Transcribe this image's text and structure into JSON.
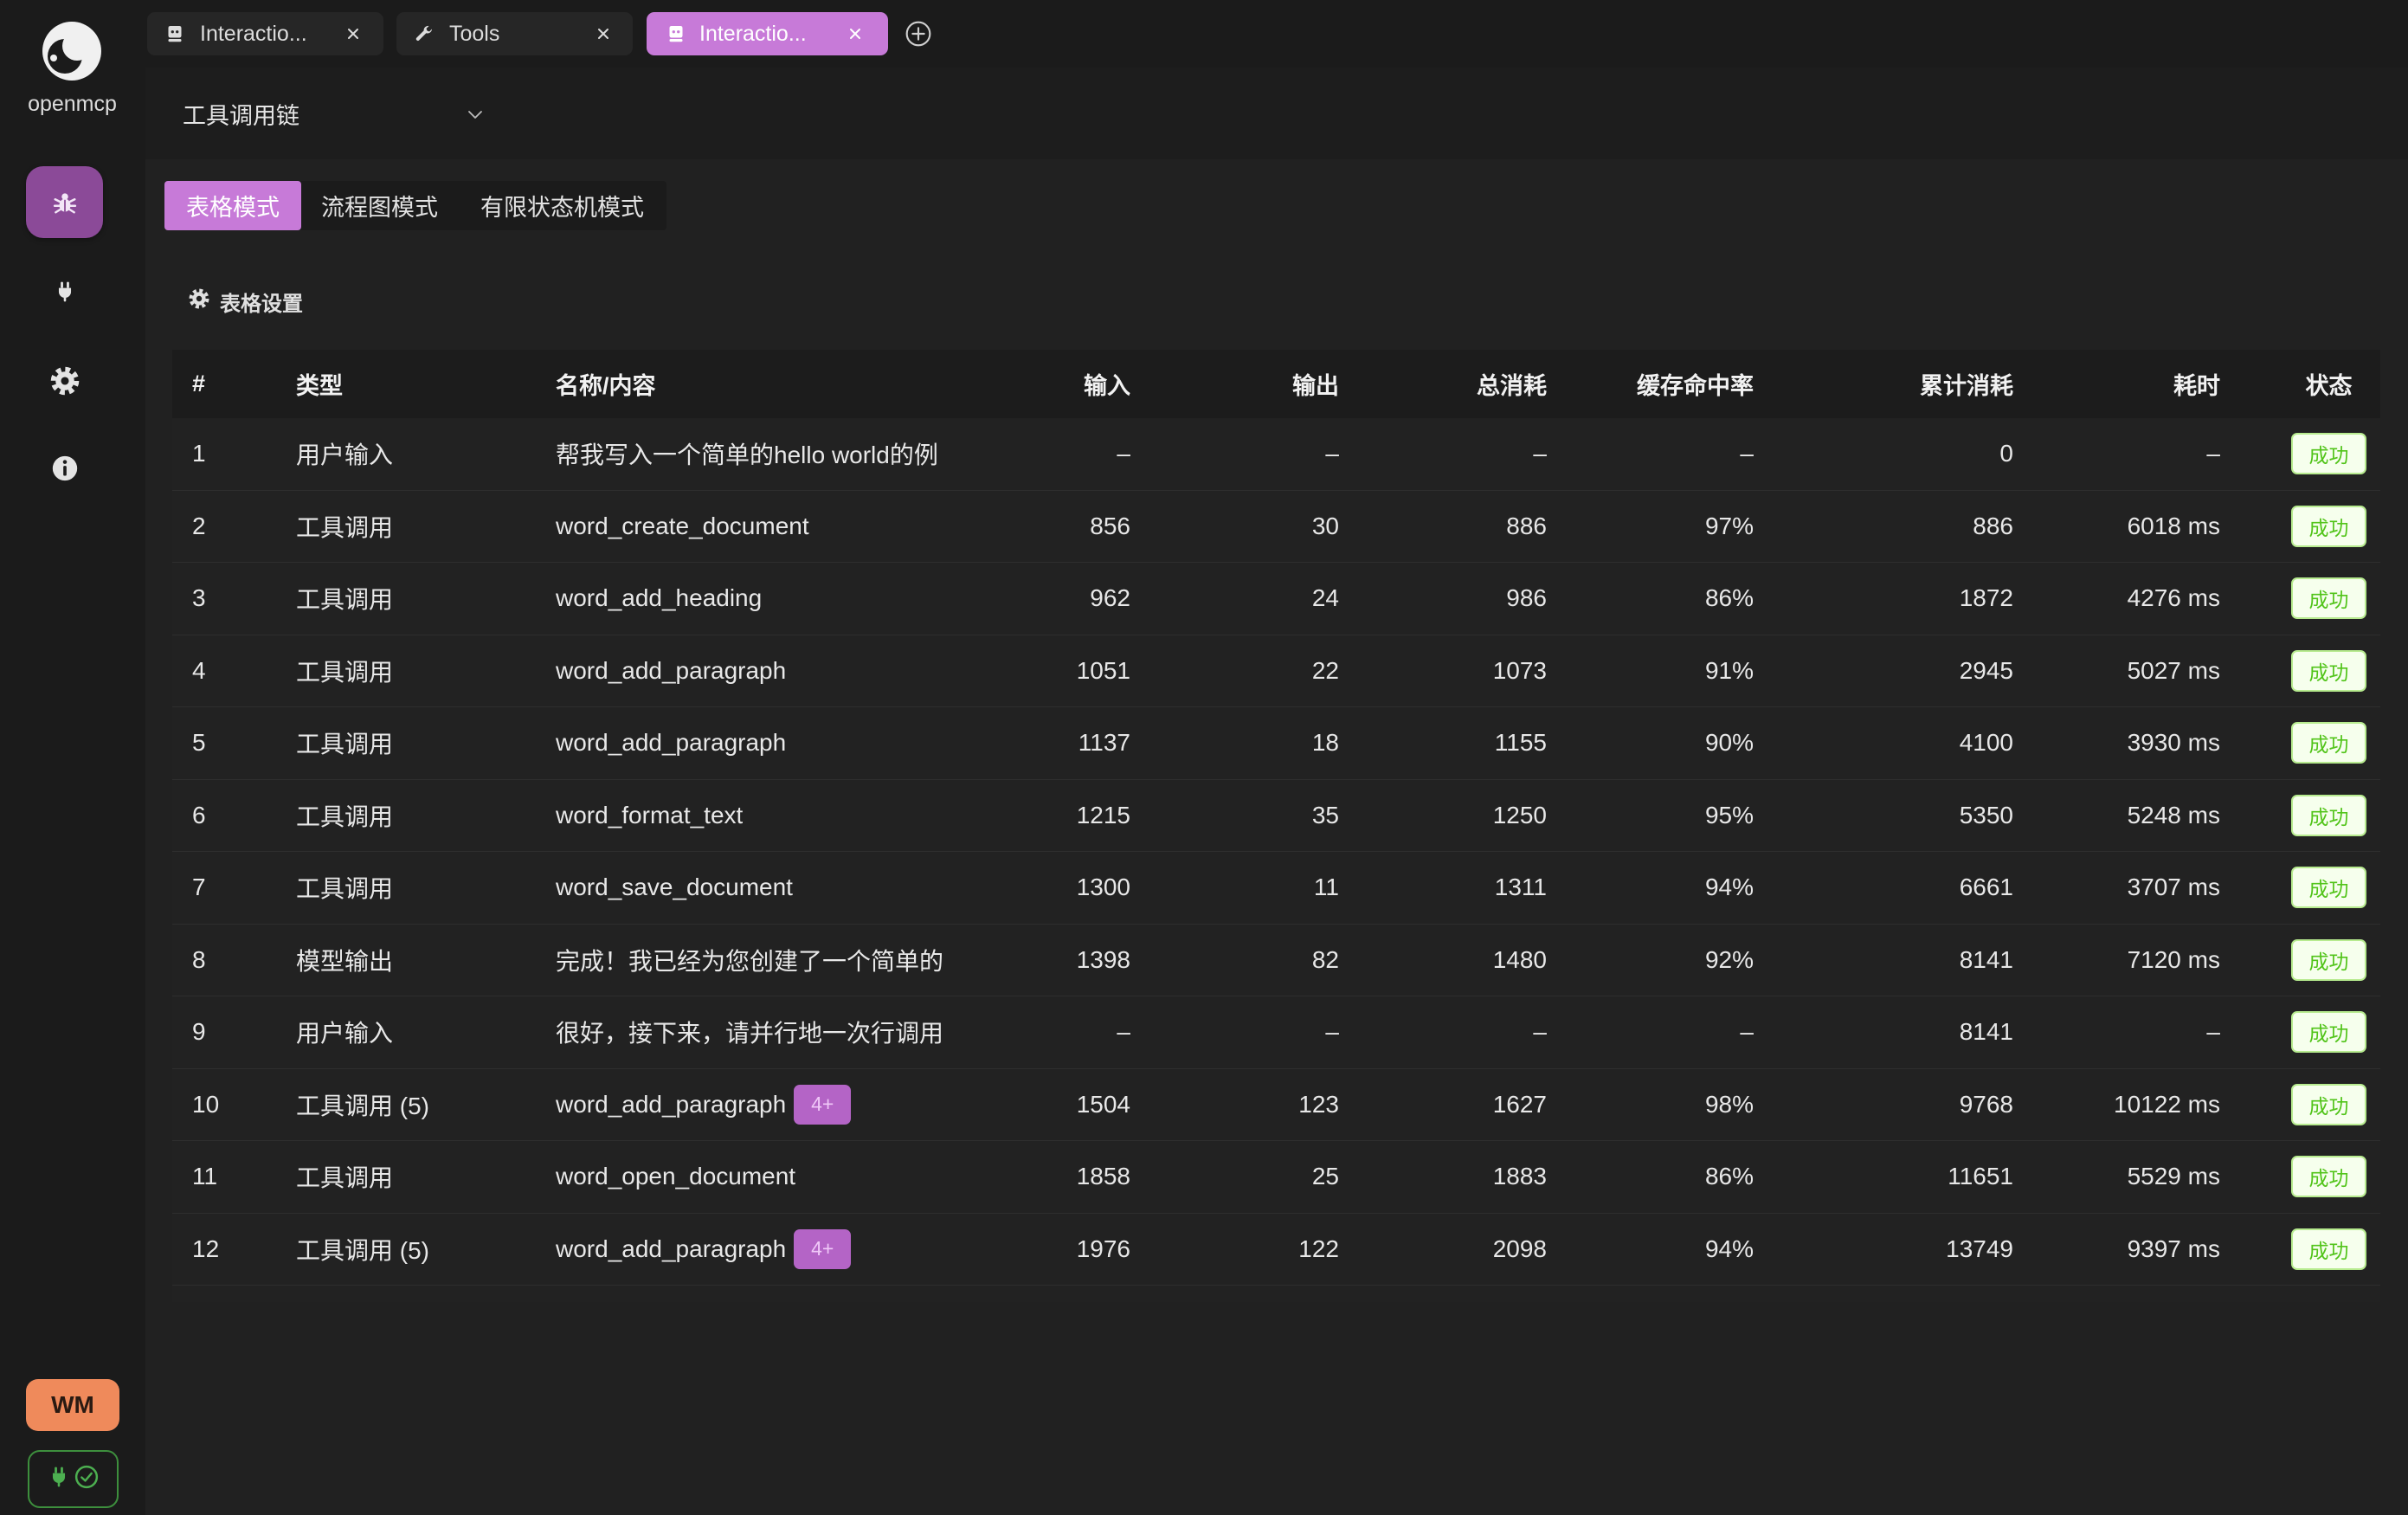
{
  "app": {
    "name": "openmcp",
    "logo_icon": "openmcp-logo"
  },
  "sidebar": {
    "items": [
      {
        "icon": "bug-icon",
        "active": true
      },
      {
        "icon": "plug-icon",
        "active": false
      },
      {
        "icon": "gear-icon",
        "active": false
      },
      {
        "icon": "info-icon",
        "active": false
      }
    ],
    "user_badge": "WM",
    "connection_status_icon": "plug-check-icon"
  },
  "tabs": [
    {
      "label": "Interactio...",
      "icon": "bot-icon",
      "active": false
    },
    {
      "label": "Tools",
      "icon": "wrench-icon",
      "active": false
    },
    {
      "label": "Interactio...",
      "icon": "bot-icon",
      "active": true
    }
  ],
  "new_tab_icon": "plus-circle-icon",
  "header": {
    "view_select": "工具调用链",
    "dropdown_icon": "chevron-down-icon"
  },
  "modes": [
    {
      "label": "表格模式",
      "active": true
    },
    {
      "label": "流程图模式",
      "active": false
    },
    {
      "label": "有限状态机模式",
      "active": false
    }
  ],
  "table_settings": {
    "label": "表格设置",
    "icon": "gear-icon"
  },
  "table": {
    "columns": [
      "#",
      "类型",
      "名称/内容",
      "输入",
      "输出",
      "总消耗",
      "缓存命中率",
      "累计消耗",
      "耗时",
      "状态"
    ],
    "rows": [
      {
        "index": "1",
        "type": "用户输入",
        "name": "帮我写入一个简单的hello world的例",
        "input": "–",
        "output": "–",
        "total": "–",
        "cache_hit": "–",
        "cumulative": "0",
        "duration": "–",
        "status": "成功"
      },
      {
        "index": "2",
        "type": "工具调用",
        "name": "word_create_document",
        "input": "856",
        "output": "30",
        "total": "886",
        "cache_hit": "97%",
        "cumulative": "886",
        "duration": "6018 ms",
        "status": "成功"
      },
      {
        "index": "3",
        "type": "工具调用",
        "name": "word_add_heading",
        "input": "962",
        "output": "24",
        "total": "986",
        "cache_hit": "86%",
        "cumulative": "1872",
        "duration": "4276 ms",
        "status": "成功"
      },
      {
        "index": "4",
        "type": "工具调用",
        "name": "word_add_paragraph",
        "input": "1051",
        "output": "22",
        "total": "1073",
        "cache_hit": "91%",
        "cumulative": "2945",
        "duration": "5027 ms",
        "status": "成功"
      },
      {
        "index": "5",
        "type": "工具调用",
        "name": "word_add_paragraph",
        "input": "1137",
        "output": "18",
        "total": "1155",
        "cache_hit": "90%",
        "cumulative": "4100",
        "duration": "3930 ms",
        "status": "成功"
      },
      {
        "index": "6",
        "type": "工具调用",
        "name": "word_format_text",
        "input": "1215",
        "output": "35",
        "total": "1250",
        "cache_hit": "95%",
        "cumulative": "5350",
        "duration": "5248 ms",
        "status": "成功"
      },
      {
        "index": "7",
        "type": "工具调用",
        "name": "word_save_document",
        "input": "1300",
        "output": "11",
        "total": "1311",
        "cache_hit": "94%",
        "cumulative": "6661",
        "duration": "3707 ms",
        "status": "成功"
      },
      {
        "index": "8",
        "type": "模型输出",
        "name": "完成！我已经为您创建了一个简单的",
        "input": "1398",
        "output": "82",
        "total": "1480",
        "cache_hit": "92%",
        "cumulative": "8141",
        "duration": "7120 ms",
        "status": "成功"
      },
      {
        "index": "9",
        "type": "用户输入",
        "name": "很好，接下来，请并行地一次行调用",
        "input": "–",
        "output": "–",
        "total": "–",
        "cache_hit": "–",
        "cumulative": "8141",
        "duration": "–",
        "status": "成功"
      },
      {
        "index": "10",
        "type": "工具调用 (5)",
        "name": "word_add_paragraph",
        "badge": "4+",
        "input": "1504",
        "output": "123",
        "total": "1627",
        "cache_hit": "98%",
        "cumulative": "9768",
        "duration": "10122 ms",
        "status": "成功"
      },
      {
        "index": "11",
        "type": "工具调用",
        "name": "word_open_document",
        "input": "1858",
        "output": "25",
        "total": "1883",
        "cache_hit": "86%",
        "cumulative": "11651",
        "duration": "5529 ms",
        "status": "成功"
      },
      {
        "index": "12",
        "type": "工具调用 (5)",
        "name": "word_add_paragraph",
        "badge": "4+",
        "input": "1976",
        "output": "122",
        "total": "2098",
        "cache_hit": "94%",
        "cumulative": "13749",
        "duration": "9397 ms",
        "status": "成功"
      }
    ]
  },
  "colors": {
    "accent": "#c77ad8",
    "sidebar_active": "#8b4a98",
    "success_text": "#52c41a",
    "success_bg": "#f6ffed",
    "success_border": "#b7eb8f",
    "badge_purple": "#b464c6",
    "user_badge_bg": "#ef8a5b",
    "connection_ok": "#4caf50"
  }
}
